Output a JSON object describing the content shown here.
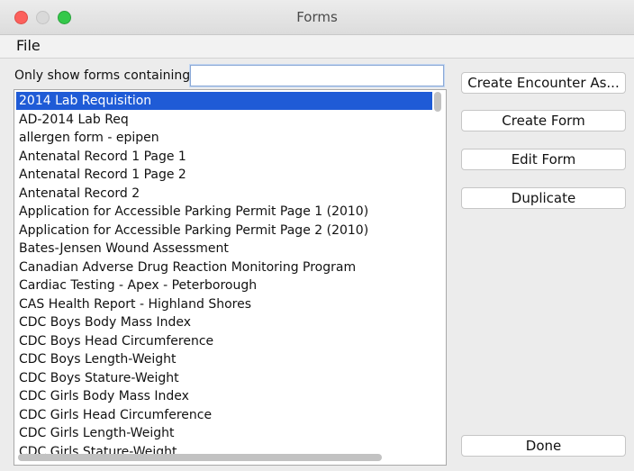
{
  "window": {
    "title": "Forms"
  },
  "menu": {
    "file": "File"
  },
  "filter": {
    "label": "Only show forms containing:",
    "value": ""
  },
  "list": {
    "items": [
      "2014 Lab Requisition",
      "AD-2014 Lab Req",
      "allergen form - epipen",
      "Antenatal Record 1 Page 1",
      "Antenatal Record 1 Page 2",
      "Antenatal Record 2",
      "Application for Accessible Parking Permit Page 1 (2010)",
      "Application for Accessible Parking Permit Page 2 (2010)",
      "Bates-Jensen Wound Assessment",
      "Canadian Adverse Drug Reaction Monitoring Program",
      "Cardiac Testing - Apex - Peterborough",
      "CAS Health Report - Highland Shores",
      "CDC Boys Body Mass Index",
      "CDC Boys Head Circumference",
      "CDC Boys Length-Weight",
      "CDC Boys Stature-Weight",
      "CDC Girls Body Mass Index",
      "CDC Girls Head Circumference",
      "CDC Girls Length-Weight",
      "CDC Girls Stature-Weight"
    ],
    "selected_index": 0
  },
  "buttons": {
    "create_encounter": "Create Encounter As...",
    "create_form": "Create Form",
    "edit_form": "Edit Form",
    "duplicate": "Duplicate",
    "done": "Done"
  },
  "colors": {
    "selection": "#1f5bd6",
    "close": "#fc605c",
    "maximize": "#34c84a"
  }
}
